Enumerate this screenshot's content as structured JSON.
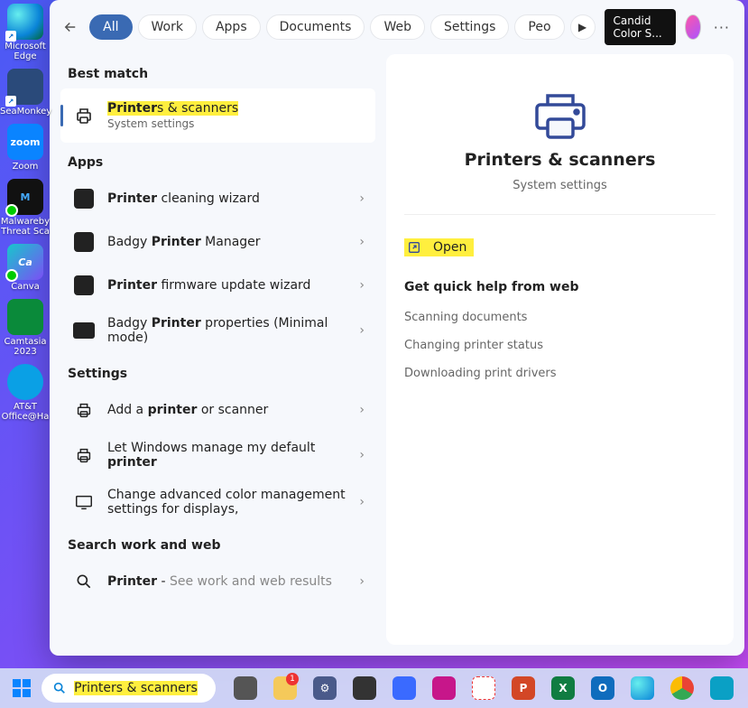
{
  "desktop": {
    "items": [
      {
        "label": "Microsoft Edge",
        "bg": "#0a84d8"
      },
      {
        "label": "SeaMonkey",
        "bg": "#2a4a7a"
      },
      {
        "label": "Zoom",
        "bg": "#0a84ff",
        "text": "zoom"
      },
      {
        "label": "Malwareby Threat Sca",
        "bg": "#111",
        "check": true
      },
      {
        "label": "Canva",
        "bg": "#17c7cc",
        "check": true
      },
      {
        "label": "Camtasia 2023",
        "bg": "#0a8a3a"
      },
      {
        "label": "AT&T Office@Ha",
        "bg": "#0aa0e5"
      }
    ]
  },
  "topbar": {
    "pills": [
      "All",
      "Work",
      "Apps",
      "Documents",
      "Web",
      "Settings",
      "Peo"
    ],
    "active_index": 0,
    "candid": "Candid Color S..."
  },
  "results": {
    "best_match_heading": "Best match",
    "best_title_bold": "Printer",
    "best_title_rest": "s & scanners",
    "best_sub": "System settings",
    "apps_heading": "Apps",
    "apps": [
      {
        "b": "Printer",
        "rest": " cleaning wizard",
        "icon": "app"
      },
      {
        "pre": "Badgy ",
        "b": "Printer",
        "rest": " Manager",
        "icon": "app"
      },
      {
        "b": "Printer",
        "rest": " firmware update wizard",
        "icon": "app"
      },
      {
        "pre": "Badgy ",
        "b": "Printer",
        "rest": " properties (Minimal mode)",
        "icon": "app-wide"
      }
    ],
    "settings_heading": "Settings",
    "settings": [
      {
        "pre": "Add a ",
        "b": "printer",
        "rest": " or scanner",
        "icon": "printer"
      },
      {
        "pre": "Let Windows manage my default ",
        "b": "printer",
        "rest": "",
        "icon": "printer"
      },
      {
        "pre": "Change advanced color management settings for displays,",
        "b": "",
        "rest": "",
        "icon": "monitor"
      }
    ],
    "web_heading": "Search work and web",
    "web": {
      "b": "Printer",
      "rest": " - ",
      "tail": "See work and web results"
    }
  },
  "preview": {
    "title": "Printers & scanners",
    "sub": "System settings",
    "open": "Open",
    "help_heading": "Get quick help from web",
    "links": [
      "Scanning documents",
      "Changing printer status",
      "Downloading print drivers"
    ]
  },
  "taskbar": {
    "search": "Printers & scanners",
    "icons": [
      {
        "name": "task-view",
        "bg": "#555"
      },
      {
        "name": "file-explorer",
        "bg": "#f5c95a",
        "badge": "1"
      },
      {
        "name": "settings",
        "bg": "#4a5a8a"
      },
      {
        "name": "calculator",
        "bg": "#333"
      },
      {
        "name": "phone",
        "bg": "#3a6aff"
      },
      {
        "name": "magenta-app",
        "bg": "#c7168a"
      },
      {
        "name": "snip",
        "bg": "#fff",
        "fg": "#e33"
      },
      {
        "name": "powerpoint",
        "bg": "#d34726",
        "text": "P"
      },
      {
        "name": "excel",
        "bg": "#107c41",
        "text": "X"
      },
      {
        "name": "outlook",
        "bg": "#0f6cbd",
        "text": "O"
      },
      {
        "name": "edge",
        "bg": "#0a84d8"
      },
      {
        "name": "chrome",
        "bg": "#fff"
      },
      {
        "name": "teal-app",
        "bg": "#0aa0c5"
      }
    ]
  }
}
